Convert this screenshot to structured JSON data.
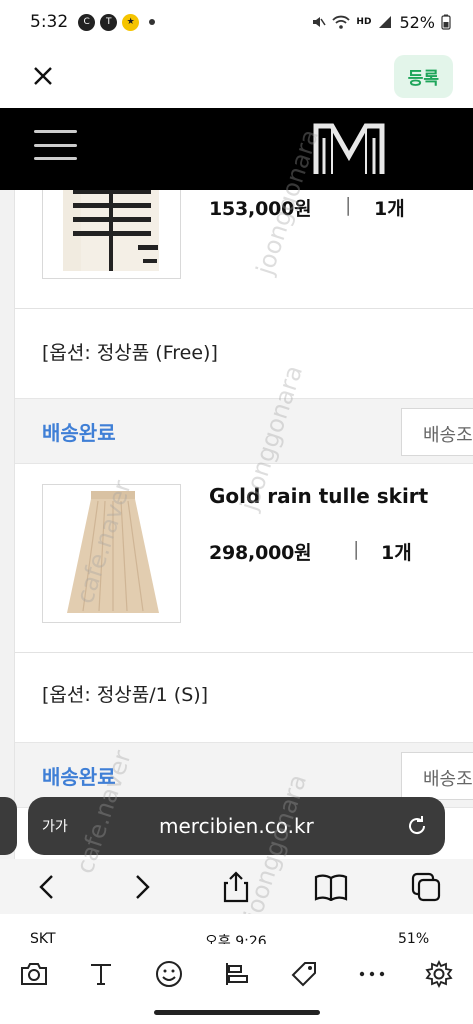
{
  "status_bar": {
    "time": "5:32",
    "icons": [
      "c-icon",
      "talk-icon",
      "yellow-app-icon",
      "dot"
    ],
    "right_icons": [
      "mute-icon",
      "wifi-icon",
      "hd-voice-icon",
      "signal-icon"
    ],
    "hd_text": "HD",
    "battery": "52%"
  },
  "top_bar": {
    "close_icon": "close-icon",
    "register_label": "등록"
  },
  "site": {
    "menu_icon": "hamburger-icon",
    "logo": "mercibien-logo"
  },
  "watermarks": [
    "joonggonara",
    "joonggonara",
    "cafe.naver",
    "cafe.naver",
    "joonggonara"
  ],
  "orders": [
    {
      "name": "",
      "price": "153,000원",
      "sep": "|",
      "qty": "1개",
      "option": "[옵션: 정상품 (Free)]",
      "shipping_status": "배송완료",
      "track_label": "배송조회"
    },
    {
      "name": "Gold rain tulle skirt",
      "price": "298,000원",
      "sep": "|",
      "qty": "1개",
      "option": "[옵션: 정상품/1 (S)]",
      "shipping_status": "배송완료",
      "track_label": "배송조회"
    }
  ],
  "browser": {
    "text_size_label": "가가",
    "url": "mercibien.co.kr",
    "reload_icon": "reload-icon",
    "nav": [
      "back-icon",
      "forward-icon",
      "share-icon",
      "bookmarks-icon",
      "tabs-icon"
    ]
  },
  "second_status": {
    "carrier": "SKT",
    "time": "오후 9:26",
    "battery": "51%"
  },
  "tools": [
    "camera-icon",
    "text-icon",
    "emoji-icon",
    "align-icon",
    "tag-icon",
    "more-icon",
    "settings-icon"
  ],
  "colors": {
    "accent_blue": "#3f7fd6",
    "register_green": "#1ea55a",
    "register_bg": "#e3f5ea",
    "header_black": "#000000"
  }
}
